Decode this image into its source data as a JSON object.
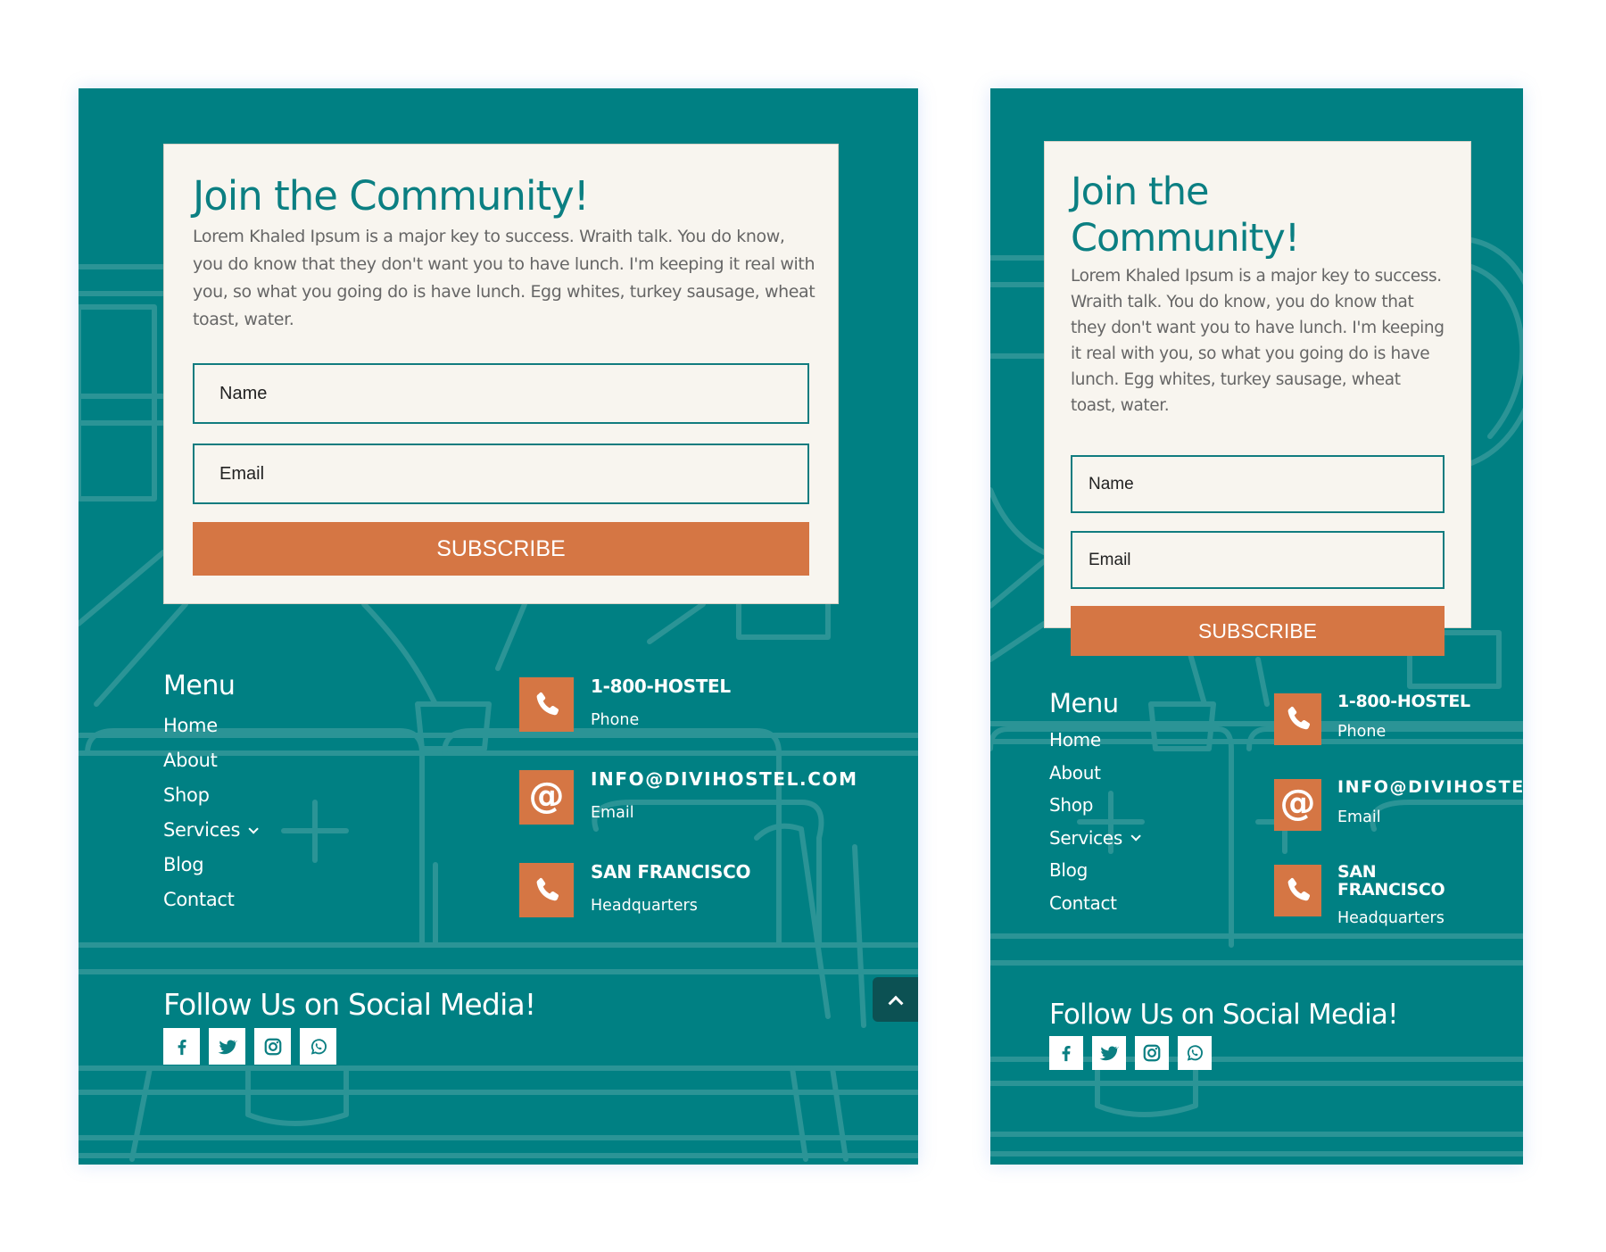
{
  "colors": {
    "teal": "#008083",
    "card": "#f8f5ef",
    "heading_teal": "#0b7f82",
    "accent_orange": "#d57644",
    "body_text": "#666666",
    "scroll_top_bg": "#0c5153"
  },
  "views": {
    "desktop": {
      "newsletter": {
        "title": "Join the Community!",
        "description": "Lorem Khaled Ipsum is a major key to success. Wraith talk. You do know, you do know that they don't want you to have lunch. I'm keeping it real with you, so what you going do is have lunch. Egg whites, turkey sausage, wheat toast, water.",
        "name_placeholder": "Name",
        "email_placeholder": "Email",
        "subscribe_label": "SUBSCRIBE"
      },
      "menu": {
        "title": "Menu",
        "items": [
          {
            "label": "Home"
          },
          {
            "label": "About"
          },
          {
            "label": "Shop"
          },
          {
            "label": "Services",
            "has_submenu": true
          },
          {
            "label": "Blog"
          },
          {
            "label": "Contact"
          }
        ]
      },
      "contacts": [
        {
          "icon": "phone-icon",
          "title": "1-800-HOSTEL",
          "subtitle": "Phone"
        },
        {
          "icon": "at-icon",
          "title": "INFO@DIVIHOSTEL.COM",
          "subtitle": "Email"
        },
        {
          "icon": "phone-icon",
          "title": "SAN FRANCISCO",
          "subtitle": "Headquarters"
        }
      ],
      "social": {
        "title": "Follow Us on Social Media!",
        "networks": [
          "facebook-icon",
          "twitter-icon",
          "instagram-icon",
          "whatsapp-icon"
        ]
      },
      "scroll_top": "scroll-to-top"
    },
    "mobile": {
      "newsletter": {
        "title": "Join the Community!",
        "description": "Lorem Khaled Ipsum is a major key to success. Wraith talk. You do know, you do know that they don't want you to have lunch. I'm keeping it real with you, so what you going do is have lunch. Egg whites, turkey sausage, wheat toast, water.",
        "name_placeholder": "Name",
        "email_placeholder": "Email",
        "subscribe_label": "SUBSCRIBE"
      },
      "menu": {
        "title": "Menu",
        "items": [
          {
            "label": "Home"
          },
          {
            "label": "About"
          },
          {
            "label": "Shop"
          },
          {
            "label": "Services",
            "has_submenu": true
          },
          {
            "label": "Blog"
          },
          {
            "label": "Contact"
          }
        ]
      },
      "contacts": [
        {
          "icon": "phone-icon",
          "title": "1-800-HOSTEL",
          "subtitle": "Phone"
        },
        {
          "icon": "at-icon",
          "title": "INFO@DIVIHOSTEL.COM",
          "subtitle": "Email"
        },
        {
          "icon": "phone-icon",
          "title": "SAN FRANCISCO",
          "subtitle": "Headquarters"
        }
      ],
      "social": {
        "title": "Follow Us on Social Media!",
        "networks": [
          "facebook-icon",
          "twitter-icon",
          "instagram-icon",
          "whatsapp-icon"
        ]
      }
    }
  }
}
